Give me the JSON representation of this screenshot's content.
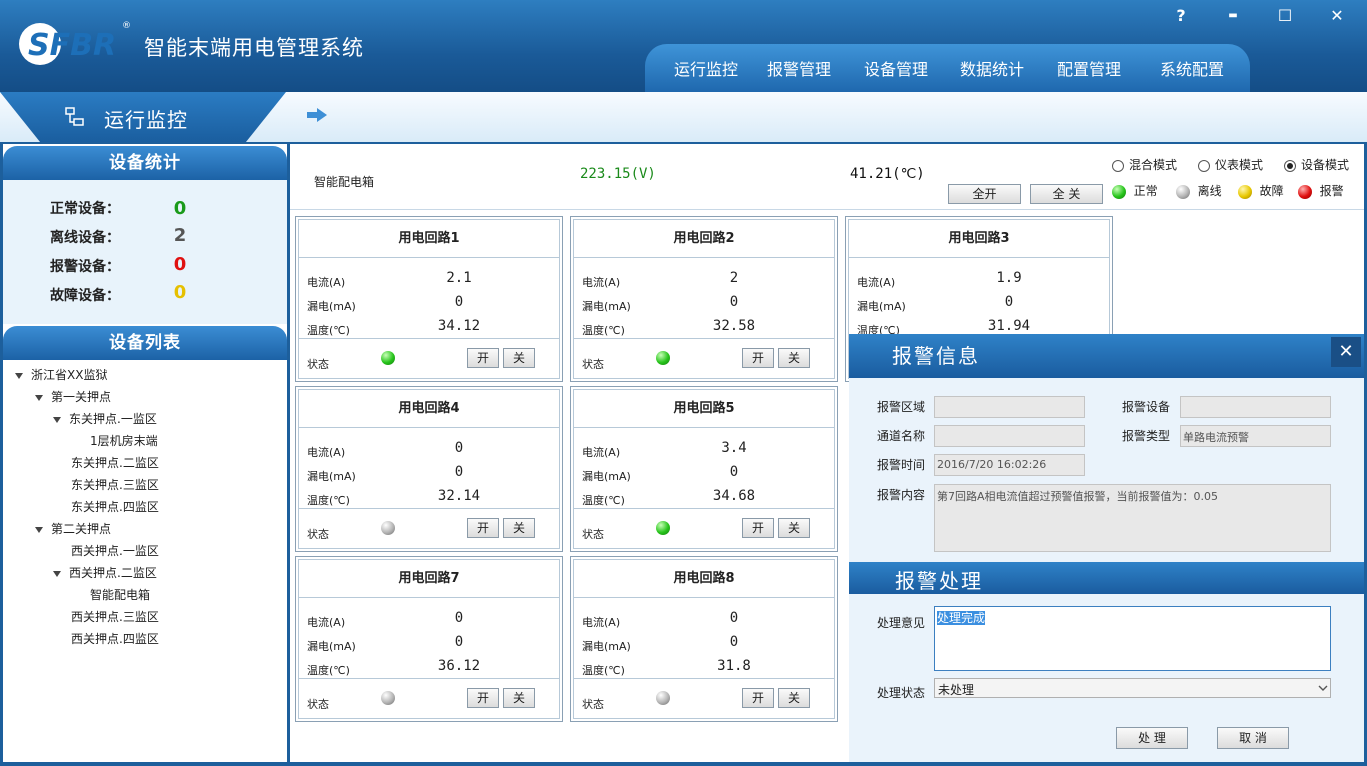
{
  "window": {
    "app_name": "智能末端用电管理系统",
    "logo_text": "SFBR",
    "registered_mark": "®",
    "help_label": "?",
    "minimize_label": "▬",
    "maximize_label": "☐",
    "close_label": "✕"
  },
  "nav": {
    "items": [
      {
        "label": "运行监控"
      },
      {
        "label": "报警管理"
      },
      {
        "label": "设备管理"
      },
      {
        "label": "数据统计"
      },
      {
        "label": "配置管理"
      },
      {
        "label": "系统配置"
      }
    ]
  },
  "subheader": {
    "title": "运行监控"
  },
  "stats": {
    "title": "设备统计",
    "items": [
      {
        "label": "正常设备：",
        "value": "0",
        "color": "#1a9a1a"
      },
      {
        "label": "离线设备：",
        "value": "2",
        "color": "#555555"
      },
      {
        "label": "报警设备：",
        "value": "0",
        "color": "#e01010"
      },
      {
        "label": "故障设备：",
        "value": "0",
        "color": "#e6c000"
      }
    ]
  },
  "device_list": {
    "title": "设备列表",
    "tree": [
      {
        "label": "浙江省XX监狱",
        "expanded": true,
        "level": 0
      },
      {
        "label": "第一关押点",
        "expanded": true,
        "level": 1
      },
      {
        "label": "东关押点.一监区",
        "expanded": true,
        "level": 2
      },
      {
        "label": "1层机房末端",
        "expanded": false,
        "level": 3
      },
      {
        "label": "东关押点.二监区",
        "expanded": false,
        "level": 2
      },
      {
        "label": "东关押点.三监区",
        "expanded": false,
        "level": 2
      },
      {
        "label": "东关押点.四监区",
        "expanded": false,
        "level": 2
      },
      {
        "label": "第二关押点",
        "expanded": true,
        "level": 1
      },
      {
        "label": "西关押点.一监区",
        "expanded": false,
        "level": 2
      },
      {
        "label": "西关押点.二监区",
        "expanded": true,
        "level": 2
      },
      {
        "label": "智能配电箱",
        "expanded": false,
        "level": 3
      },
      {
        "label": "西关押点.三监区",
        "expanded": false,
        "level": 2
      },
      {
        "label": "西关押点.四监区",
        "expanded": false,
        "level": 2
      }
    ]
  },
  "box": {
    "name": "智能配电箱",
    "voltage": "223.15(V)",
    "temperature": "41.21(℃)",
    "open_all_label": "全开",
    "close_all_label": "全 关"
  },
  "modes": {
    "options": [
      {
        "label": "混合模式",
        "selected": false
      },
      {
        "label": "仪表模式",
        "selected": false
      },
      {
        "label": "设备模式",
        "selected": true
      }
    ]
  },
  "legend": [
    {
      "label": "正常",
      "color": "green"
    },
    {
      "label": "离线",
      "color": "gray"
    },
    {
      "label": "故障",
      "color": "yellow"
    },
    {
      "label": "报警",
      "color": "red"
    }
  ],
  "circuit_labels": {
    "current": "电流(A)",
    "leakage": "漏电(mA)",
    "temperature": "温度(℃)",
    "status": "状态",
    "on": "开",
    "off": "关"
  },
  "circuits": [
    {
      "title": "用电回路1",
      "current": "2.1",
      "leakage": "0",
      "temperature": "34.12",
      "status": "green"
    },
    {
      "title": "用电回路2",
      "current": "2",
      "leakage": "0",
      "temperature": "32.58",
      "status": "green"
    },
    {
      "title": "用电回路3",
      "current": "1.9",
      "leakage": "0",
      "temperature": "31.94",
      "status": "green"
    },
    {
      "title": "用电回路4",
      "current": "0",
      "leakage": "0",
      "temperature": "32.14",
      "status": "gray"
    },
    {
      "title": "用电回路5",
      "current": "3.4",
      "leakage": "0",
      "temperature": "34.68",
      "status": "green"
    },
    {
      "title": "用电回路7",
      "current": "0",
      "leakage": "0",
      "temperature": "36.12",
      "status": "gray"
    },
    {
      "title": "用电回路8",
      "current": "0",
      "leakage": "0",
      "temperature": "31.8",
      "status": "gray"
    }
  ],
  "alarm_dialog": {
    "title": "报警信息",
    "close_label": "✕",
    "area_label": "报警区域",
    "area_value": "",
    "device_label": "报警设备",
    "device_value": "",
    "channel_label": "通道名称",
    "channel_value": "",
    "type_label": "报警类型",
    "type_value": "单路电流预警",
    "time_label": "报警时间",
    "time_value": "2016/7/20 16:02:26",
    "content_label": "报警内容",
    "content_value": "第7回路A相电流值超过预警值报警，当前报警值为：0.05",
    "process_title": "报警处理",
    "opinion_label": "处理意见",
    "opinion_value": "处理完成",
    "state_label": "处理状态",
    "state_value": "未处理",
    "process_button": "处 理",
    "cancel_button": "取 消"
  }
}
